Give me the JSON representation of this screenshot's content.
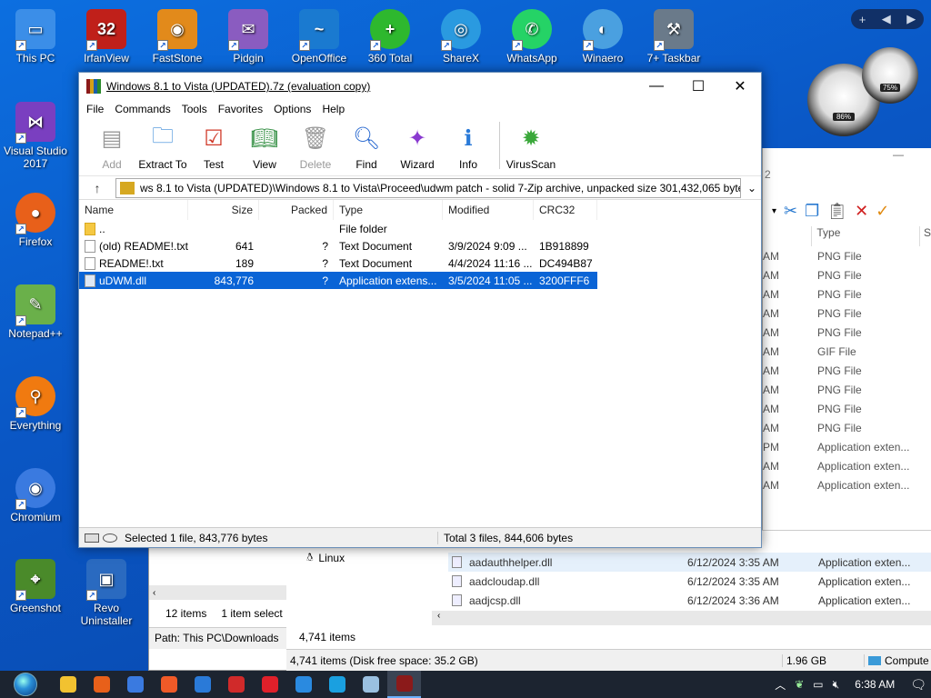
{
  "desktop_icons": [
    {
      "label": "This PC",
      "color": "#3b8ee8"
    },
    {
      "label": "IrfanView",
      "color": "#c0201a"
    },
    {
      "label": "FastStone",
      "color": "#e28a1b"
    },
    {
      "label": "Pidgin",
      "color": "#8a5cc0"
    },
    {
      "label": "OpenOffice",
      "color": "#1a7ad0"
    },
    {
      "label": "360 Total",
      "color": "#2eb82e"
    },
    {
      "label": "ShareX",
      "color": "#2a9ae0"
    },
    {
      "label": "WhatsApp",
      "color": "#25d366"
    },
    {
      "label": "Winaero",
      "color": "#4aa0e0"
    },
    {
      "label": "7+ Taskbar",
      "color": "#6a7a8a"
    },
    {
      "label": "Visual Studio 2017",
      "color": "#7a3fc0"
    },
    {
      "label": "Firefox",
      "color": "#e8601a"
    },
    {
      "label": "Notepad++",
      "color": "#6ab04a"
    },
    {
      "label": "Everything",
      "color": "#f07a10"
    },
    {
      "label": "Chromium",
      "color": "#3a7ae0"
    },
    {
      "label": "Greenshot",
      "color": "#4a8a2a"
    },
    {
      "label": "Revo Uninstaller",
      "color": "#2a6ac0"
    }
  ],
  "gadgets": {
    "gauge1": "86%",
    "gauge2": "75%",
    "bar_glyphs": [
      "+",
      "◀",
      "▶"
    ]
  },
  "winrar": {
    "title": "Windows 8.1 to Vista (UPDATED).7z (evaluation copy)",
    "menu": [
      "File",
      "Commands",
      "Tools",
      "Favorites",
      "Options",
      "Help"
    ],
    "toolbar": [
      {
        "label": "Add",
        "icon": "add-icon",
        "color": "#6a5a4a",
        "disabled": true
      },
      {
        "label": "Extract To",
        "icon": "extract-folder-icon",
        "color": "#3a8ad8",
        "disabled": false
      },
      {
        "label": "Test",
        "icon": "test-checklist-icon",
        "color": "#d03a2a",
        "disabled": false
      },
      {
        "label": "View",
        "icon": "book-icon",
        "color": "#2a8a3a",
        "disabled": false
      },
      {
        "label": "Delete",
        "icon": "trash-icon",
        "color": "#888888",
        "disabled": true
      },
      {
        "label": "Find",
        "icon": "magnifier-icon",
        "color": "#2a6ad0",
        "disabled": false
      },
      {
        "label": "Wizard",
        "icon": "wand-icon",
        "color": "#8a3ad0",
        "disabled": false
      },
      {
        "label": "Info",
        "icon": "info-icon",
        "color": "#2a7ad8",
        "disabled": false
      },
      {
        "label": "VirusScan",
        "icon": "virus-icon",
        "color": "#3aa83a",
        "disabled": false
      }
    ],
    "path": "ws 8.1 to Vista (UPDATED)\\Windows 8.1 to Vista\\Proceed\\udwm patch - solid 7-Zip archive, unpacked size 301,432,065 bytes",
    "columns": {
      "name": "Name",
      "size": "Size",
      "packed": "Packed",
      "type": "Type",
      "modified": "Modified",
      "crc": "CRC32"
    },
    "rows": [
      {
        "name": "..",
        "size": "",
        "packed": "",
        "type": "File folder",
        "modified": "",
        "crc": "",
        "kind": "folder",
        "selected": false
      },
      {
        "name": "(old) README!.txt",
        "size": "641",
        "packed": "?",
        "type": "Text Document",
        "modified": "3/9/2024 9:09 ...",
        "crc": "1B918899",
        "kind": "txt",
        "selected": false
      },
      {
        "name": "README!.txt",
        "size": "189",
        "packed": "?",
        "type": "Text Document",
        "modified": "4/4/2024 11:16 ...",
        "crc": "DC494B87",
        "kind": "txt",
        "selected": false
      },
      {
        "name": "uDWM.dll",
        "size": "843,776",
        "packed": "?",
        "type": "Application extens...",
        "modified": "3/5/2024 11:05 ...",
        "crc": "3200FFF6",
        "kind": "dll",
        "selected": true
      }
    ],
    "status": {
      "left": "Selected 1 file, 843,776 bytes",
      "right": "Total 3 files, 844,606 bytes"
    }
  },
  "explorer_right": {
    "column_type": "Type",
    "column_next": "S",
    "partial_col": "2",
    "types": [
      {
        "time": "AM",
        "type": "PNG File"
      },
      {
        "time": "AM",
        "type": "PNG File"
      },
      {
        "time": "AM",
        "type": "PNG File"
      },
      {
        "time": "AM",
        "type": "PNG File"
      },
      {
        "time": "AM",
        "type": "PNG File"
      },
      {
        "time": "AM",
        "type": "GIF File"
      },
      {
        "time": "AM",
        "type": "PNG File"
      },
      {
        "time": "AM",
        "type": "PNG File"
      },
      {
        "time": "AM",
        "type": "PNG File"
      },
      {
        "time": "AM",
        "type": "PNG File"
      },
      {
        "time": "PM",
        "type": "Application exten..."
      },
      {
        "time": "AM",
        "type": "Application exten..."
      },
      {
        "time": "AM",
        "type": "Application exten..."
      }
    ]
  },
  "explorer_mid": {
    "nav_item": "Linux",
    "files": [
      {
        "name": "aadauthhelper.dll",
        "date": "6/12/2024 3:35 AM",
        "type": "Application exten..."
      },
      {
        "name": "aadcloudap.dll",
        "date": "6/12/2024 3:35 AM",
        "type": "Application exten..."
      },
      {
        "name": "aadjcsp.dll",
        "date": "6/12/2024 3:36 AM",
        "type": "Application exten..."
      }
    ],
    "items_count": "4,741 items",
    "status_left": "4,741 items (Disk free space: 35.2 GB)",
    "status_size": "1.96 GB",
    "status_computer": "Compute"
  },
  "explorer_left": {
    "items": "12 items",
    "selected": "1 item select",
    "path": "Path: This PC\\Downloads"
  },
  "taskbar": {
    "apps": [
      {
        "name": "file-explorer",
        "color": "#f2c230"
      },
      {
        "name": "firefox",
        "color": "#e8601a"
      },
      {
        "name": "chromium",
        "color": "#3a7ae0"
      },
      {
        "name": "brave",
        "color": "#f05a28"
      },
      {
        "name": "thunderbird",
        "color": "#2a7ad8"
      },
      {
        "name": "wps",
        "color": "#d02a2a"
      },
      {
        "name": "opera",
        "color": "#e0202a"
      },
      {
        "name": "ccleaner",
        "color": "#2a8ae0"
      },
      {
        "name": "skype",
        "color": "#1aa0e0"
      },
      {
        "name": "notepad",
        "color": "#9ac0e0"
      },
      {
        "name": "winrar",
        "color": "#8b1a1a"
      }
    ],
    "time": "6:38 AM"
  }
}
